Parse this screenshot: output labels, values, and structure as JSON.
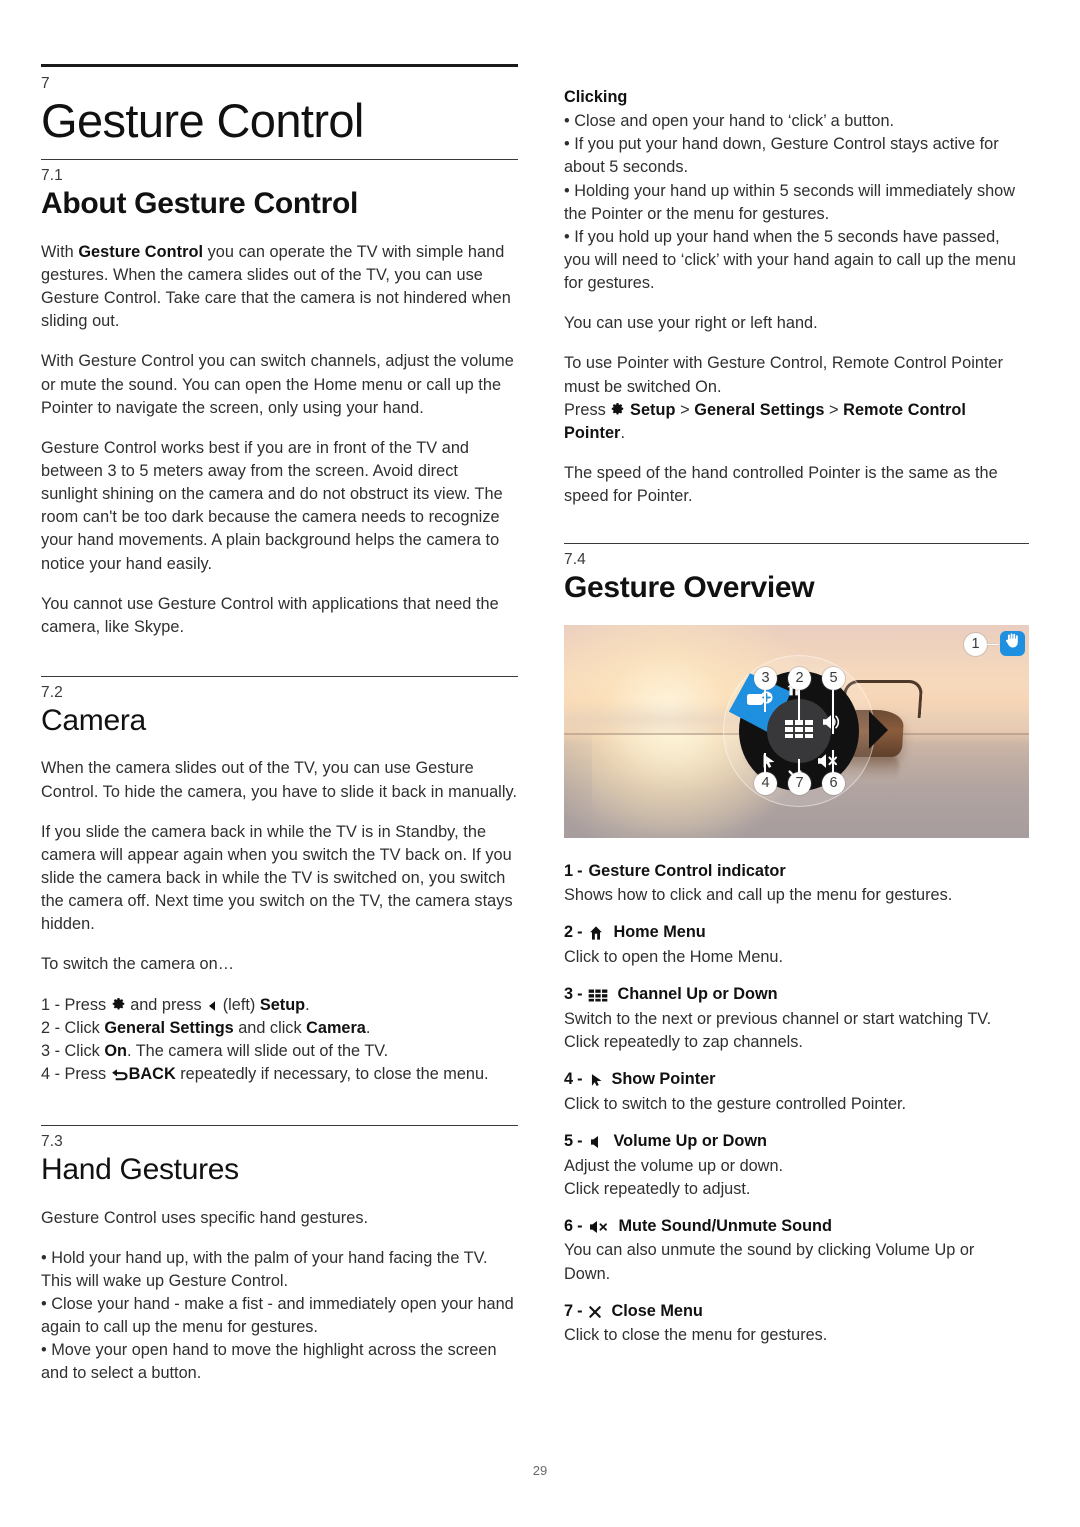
{
  "page": {
    "number": "29"
  },
  "chapter": {
    "num": "7",
    "title": "Gesture Control"
  },
  "left": {
    "s71": {
      "num": "7.1",
      "title": "About Gesture Control",
      "p1_a": "With ",
      "p1_b": "Gesture Control",
      "p1_c": " you can operate the TV with simple hand gestures. When the camera slides out of the TV, you can use Gesture Control. Take care that the camera is not hindered when sliding out.",
      "p2": "With Gesture Control you can switch channels, adjust the volume or mute the sound. You can open the Home menu or call up the Pointer to navigate the screen, only using your hand.",
      "p3": "Gesture Control works best if you are in front of the TV and between 3 to 5 meters away from the screen. Avoid direct sunlight shining on the camera and do not obstruct its view. The room can't be too dark because the camera needs to recognize your hand movements. A plain background helps the camera to notice your hand easily.",
      "p4": "You cannot use Gesture Control with applications that need the camera, like Skype."
    },
    "s72": {
      "num": "7.2",
      "title": "Camera",
      "p1": "When the camera slides out of the TV, you can use Gesture Control. To hide the camera, you have to slide it back in manually.",
      "p2": "If you slide the camera back in while the TV is in Standby, the camera will appear again when you switch the TV back on. If you slide the camera back in while the TV is switched on, you switch the camera off. Next time you switch on the TV, the camera stays hidden.",
      "p3": "To switch the camera on…",
      "step1_a": "1 - Press ",
      "step1_b": " and press ",
      "step1_c": " (left) ",
      "step1_d": "Setup",
      "step1_e": ".",
      "step2_a": "2 - Click ",
      "step2_b": "General Settings",
      "step2_c": " and click ",
      "step2_d": "Camera",
      "step2_e": ".",
      "step3_a": "3 - Click ",
      "step3_b": "On",
      "step3_c": ". The camera will slide out of the TV.",
      "step4_a": "4 - Press ",
      "step4_b": "BACK",
      "step4_c": " repeatedly if necessary, to close the menu."
    },
    "s73": {
      "num": "7.3",
      "title": "Hand Gestures",
      "p1": "Gesture Control uses specific hand gestures.",
      "b1": "• Hold your hand up, with the palm of your hand facing the TV. This will wake up Gesture Control.",
      "b2": "• Close your hand - make a fist - and immediately open your hand again to call up the menu for gestures.",
      "b3": "• Move your open hand to move the highlight across the screen and to select a button."
    }
  },
  "right": {
    "clicking": {
      "heading": "Clicking",
      "b1": "• Close and open your hand to ‘click’ a button.",
      "b2": "• If you put your hand down, Gesture Control stays active for about 5 seconds.",
      "b3": "• Holding your hand up within 5 seconds will immediately show the Pointer or the menu for gestures.",
      "b4": "• If you hold up your hand when the 5 seconds have passed, you will need to ‘click’ with your hand again to call up the menu for gestures.",
      "p1": "You can use your right or left hand.",
      "p2": "To use Pointer with Gesture Control, Remote Control Pointer must be switched On.",
      "press_a": "Press ",
      "press_setup": "Setup",
      "press_gt1": " > ",
      "press_general": "General Settings",
      "press_gt2": " > ",
      "press_rcp": "Remote Control Pointer",
      "press_end": ".",
      "p3": "The speed of the hand controlled Pointer is the same as the speed for Pointer."
    },
    "s74": {
      "num": "7.4",
      "title": "Gesture Overview",
      "figure": {
        "callouts": [
          "1",
          "2",
          "3",
          "4",
          "5",
          "6",
          "7"
        ],
        "indicator_icon": "hand-icon",
        "indicator_color": "#1f8fe0",
        "wheel_icons": [
          "home-icon",
          "camera-add-icon",
          "channel-grid-icon",
          "volume-icon",
          "pointer-icon",
          "mute-icon",
          "close-icon"
        ]
      },
      "items": [
        {
          "num": "1",
          "icon": "",
          "title": "Gesture Control indicator",
          "desc": "Shows how to click and call up the menu for gestures."
        },
        {
          "num": "2",
          "icon": "home-icon",
          "title": "Home Menu",
          "desc": "Click to open the Home Menu."
        },
        {
          "num": "3",
          "icon": "channel-grid-icon",
          "title": "Channel Up or Down",
          "desc": "Switch to the next or previous channel or start watching TV.\nClick repeatedly to zap channels."
        },
        {
          "num": "4",
          "icon": "pointer-icon",
          "title": "Show Pointer",
          "desc": "Click to switch to the gesture controlled Pointer."
        },
        {
          "num": "5",
          "icon": "volume-icon",
          "title": "Volume Up or Down",
          "desc": "Adjust the volume up or down.\nClick repeatedly to adjust."
        },
        {
          "num": "6",
          "icon": "mute-icon",
          "title": "Mute Sound/Unmute Sound",
          "desc": "You can also unmute the sound by clicking Volume Up or\nDown."
        },
        {
          "num": "7",
          "icon": "close-icon",
          "title": "Close Menu",
          "desc": "Click to close the menu for gestures."
        }
      ]
    }
  }
}
